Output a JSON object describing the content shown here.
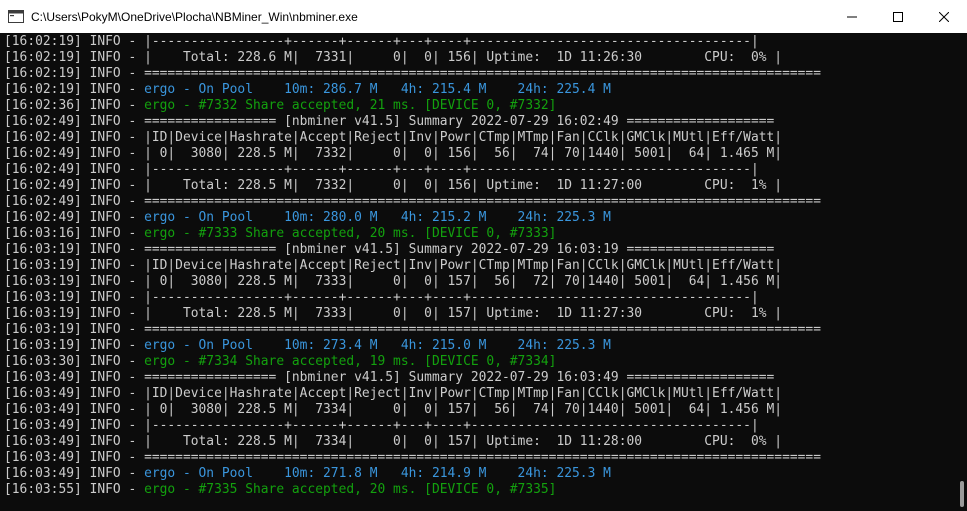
{
  "window": {
    "title": "C:\\Users\\PokyM\\OneDrive\\Plocha\\NBMiner_Win\\nbminer.exe",
    "icons": {
      "app": "console-window-icon",
      "minimize": "minimize-icon",
      "maximize": "maximize-icon",
      "close": "close-icon"
    }
  },
  "colors": {
    "background": "#0c0c0c",
    "text": "#cccccc",
    "pool": "#3a96dd",
    "share": "#13a10e"
  },
  "console": {
    "lines": [
      {
        "prefix": "[16:02:19] INFO - ",
        "message": "|-----------------+------+------+---+----+------------------------------------|",
        "type": "normal"
      },
      {
        "prefix": "[16:02:19] INFO - ",
        "message": "|    Total: 228.6 M|  7331|     0|  0| 156| Uptime:  1D 11:26:30        CPU:  0% |",
        "type": "normal"
      },
      {
        "prefix": "[16:02:19] INFO - ",
        "message": "=======================================================================================",
        "type": "normal"
      },
      {
        "prefix": "[16:02:19] INFO - ",
        "message": "ergo - On Pool    10m: 286.7 M   4h: 215.4 M    24h: 225.4 M",
        "type": "pool"
      },
      {
        "prefix": "[16:02:36] INFO - ",
        "message": "ergo - #7332 Share accepted, 21 ms. [DEVICE 0, #7332]",
        "type": "share"
      },
      {
        "prefix": "[16:02:49] INFO - ",
        "message": "================= [nbminer v41.5] Summary 2022-07-29 16:02:49 ===================",
        "type": "normal"
      },
      {
        "prefix": "[16:02:49] INFO - ",
        "message": "|ID|Device|Hashrate|Accept|Reject|Inv|Powr|CTmp|MTmp|Fan|CClk|GMClk|MUtl|Eff/Watt|",
        "type": "normal"
      },
      {
        "prefix": "[16:02:49] INFO - ",
        "message": "| 0|  3080| 228.5 M|  7332|     0|  0| 156|  56|  74| 70|1440| 5001|  64| 1.465 M|",
        "type": "normal"
      },
      {
        "prefix": "[16:02:49] INFO - ",
        "message": "|-----------------+------+------+---+----+------------------------------------|",
        "type": "normal"
      },
      {
        "prefix": "[16:02:49] INFO - ",
        "message": "|    Total: 228.5 M|  7332|     0|  0| 156| Uptime:  1D 11:27:00        CPU:  1% |",
        "type": "normal"
      },
      {
        "prefix": "[16:02:49] INFO - ",
        "message": "=======================================================================================",
        "type": "normal"
      },
      {
        "prefix": "[16:02:49] INFO - ",
        "message": "ergo - On Pool    10m: 280.0 M   4h: 215.2 M    24h: 225.3 M",
        "type": "pool"
      },
      {
        "prefix": "[16:03:16] INFO - ",
        "message": "ergo - #7333 Share accepted, 20 ms. [DEVICE 0, #7333]",
        "type": "share"
      },
      {
        "prefix": "[16:03:19] INFO - ",
        "message": "================= [nbminer v41.5] Summary 2022-07-29 16:03:19 ===================",
        "type": "normal"
      },
      {
        "prefix": "[16:03:19] INFO - ",
        "message": "|ID|Device|Hashrate|Accept|Reject|Inv|Powr|CTmp|MTmp|Fan|CClk|GMClk|MUtl|Eff/Watt|",
        "type": "normal"
      },
      {
        "prefix": "[16:03:19] INFO - ",
        "message": "| 0|  3080| 228.5 M|  7333|     0|  0| 157|  56|  72| 70|1440| 5001|  64| 1.456 M|",
        "type": "normal"
      },
      {
        "prefix": "[16:03:19] INFO - ",
        "message": "|-----------------+------+------+---+----+------------------------------------|",
        "type": "normal"
      },
      {
        "prefix": "[16:03:19] INFO - ",
        "message": "|    Total: 228.5 M|  7333|     0|  0| 157| Uptime:  1D 11:27:30        CPU:  1% |",
        "type": "normal"
      },
      {
        "prefix": "[16:03:19] INFO - ",
        "message": "=======================================================================================",
        "type": "normal"
      },
      {
        "prefix": "[16:03:19] INFO - ",
        "message": "ergo - On Pool    10m: 273.4 M   4h: 215.0 M    24h: 225.3 M",
        "type": "pool"
      },
      {
        "prefix": "[16:03:30] INFO - ",
        "message": "ergo - #7334 Share accepted, 19 ms. [DEVICE 0, #7334]",
        "type": "share"
      },
      {
        "prefix": "[16:03:49] INFO - ",
        "message": "================= [nbminer v41.5] Summary 2022-07-29 16:03:49 ===================",
        "type": "normal"
      },
      {
        "prefix": "[16:03:49] INFO - ",
        "message": "|ID|Device|Hashrate|Accept|Reject|Inv|Powr|CTmp|MTmp|Fan|CClk|GMClk|MUtl|Eff/Watt|",
        "type": "normal"
      },
      {
        "prefix": "[16:03:49] INFO - ",
        "message": "| 0|  3080| 228.5 M|  7334|     0|  0| 157|  56|  74| 70|1440| 5001|  64| 1.456 M|",
        "type": "normal"
      },
      {
        "prefix": "[16:03:49] INFO - ",
        "message": "|-----------------+------+------+---+----+------------------------------------|",
        "type": "normal"
      },
      {
        "prefix": "[16:03:49] INFO - ",
        "message": "|    Total: 228.5 M|  7334|     0|  0| 157| Uptime:  1D 11:28:00        CPU:  0% |",
        "type": "normal"
      },
      {
        "prefix": "[16:03:49] INFO - ",
        "message": "=======================================================================================",
        "type": "normal"
      },
      {
        "prefix": "[16:03:49] INFO - ",
        "message": "ergo - On Pool    10m: 271.8 M   4h: 214.9 M    24h: 225.3 M",
        "type": "pool"
      },
      {
        "prefix": "[16:03:55] INFO - ",
        "message": "ergo - #7335 Share accepted, 20 ms. [DEVICE 0, #7335]",
        "type": "share"
      }
    ]
  }
}
